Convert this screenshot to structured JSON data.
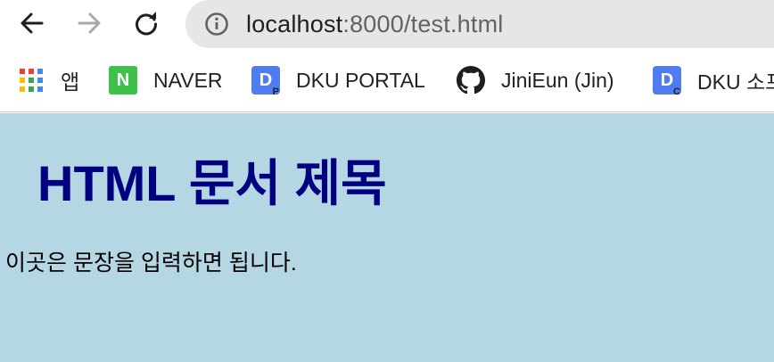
{
  "toolbar": {
    "back_icon": "back-arrow-icon",
    "forward_icon": "forward-arrow-icon",
    "reload_icon": "reload-icon",
    "site_info_icon": "info-icon",
    "url_host": "localhost",
    "url_rest": ":8000/test.html"
  },
  "bookmarks": {
    "items": [
      {
        "label": "앱",
        "icon": "apps-grid-icon"
      },
      {
        "label": "NAVER",
        "icon": "naver-icon",
        "icon_text": "N"
      },
      {
        "label": "DKU PORTAL",
        "icon": "dku-portal-icon",
        "icon_text": "D",
        "icon_sub": "P"
      },
      {
        "label": "JiniEun (Jin)",
        "icon": "github-icon"
      },
      {
        "label": "DKU 소프",
        "icon": "dku-icon",
        "icon_text": "D",
        "icon_sub": "C"
      }
    ]
  },
  "page": {
    "heading": "HTML 문서 제목",
    "paragraph": "이곳은 문장을 입력하면 됩니다.",
    "background_color": "#b4d7e3",
    "heading_color": "#000080"
  },
  "colors": {
    "omnibox_bg": "#e6e6e6",
    "naver_green": "#3ec04a",
    "dku_blue": "#4f7cf0"
  }
}
